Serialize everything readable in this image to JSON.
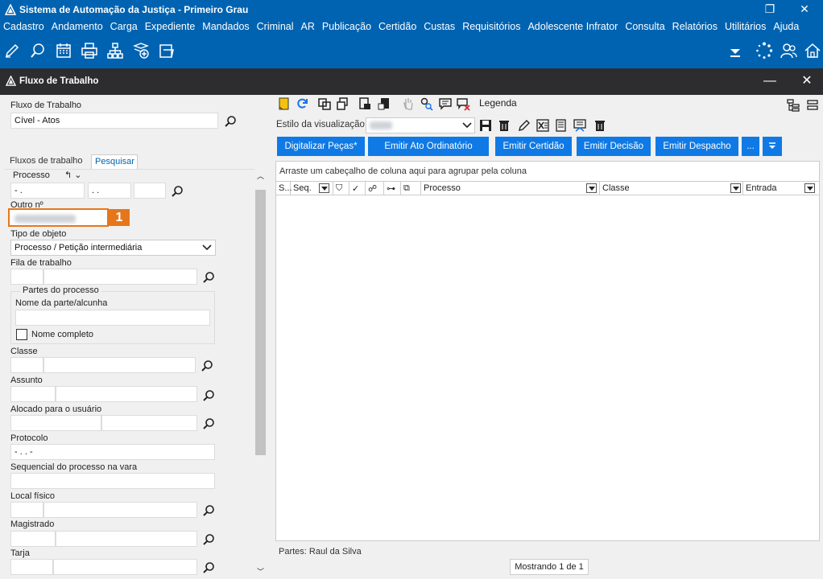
{
  "titlebar": {
    "title": "Sistema de Automação da Justiça - Primeiro Grau"
  },
  "menu": {
    "items": [
      "Cadastro",
      "Andamento",
      "Carga",
      "Expediente",
      "Mandados",
      "Criminal",
      "AR",
      "Publicação",
      "Certidão",
      "Custas",
      "Requisitórios",
      "Adolescente Infrator",
      "Consulta",
      "Relatórios",
      "Utilitários",
      "Ajuda"
    ]
  },
  "window": {
    "title": "Fluxo de Trabalho"
  },
  "left": {
    "flow_label": "Fluxo de Trabalho",
    "flow_value": "Cível - Atos",
    "tabs": [
      "Fluxos de trabalho",
      "Pesquisar"
    ],
    "processo_label": "Processo",
    "processo_seg1": "- .",
    "processo_seg2": ". .",
    "outro_label": "Outro nº",
    "marker": "1",
    "tipo_label": "Tipo de objeto",
    "tipo_value": "Processo / Petição intermediária",
    "fila_label": "Fila de trabalho",
    "partes_group": "Partes do processo",
    "nome_parte_label": "Nome da parte/alcunha",
    "nome_completo_label": "Nome completo",
    "classe_label": "Classe",
    "assunto_label": "Assunto",
    "alocado_label": "Alocado para o usuário",
    "protocolo_label": "Protocolo",
    "protocolo_value": "- . . -",
    "sequencial_label": "Sequencial do processo na vara",
    "local_label": "Local físico",
    "magistrado_label": "Magistrado",
    "tarja_label": "Tarja"
  },
  "right": {
    "legenda_label": "Legenda",
    "estilo_label": "Estilo da visualização",
    "buttons": [
      "Digitalizar Peças*",
      "Emitir Ato Ordinatório",
      "Emitir Certidão",
      "Emitir Decisão",
      "Emitir Despacho",
      "..."
    ],
    "group_hint": "Arraste um cabeçalho de coluna aqui para agrupar pela coluna",
    "columns": [
      "S...",
      "Seq.",
      "Processo",
      "Classe",
      "Entrada"
    ],
    "partes_footer": "Partes: Raul da Silva",
    "mostrando": "Mostrando 1 de 1"
  },
  "colors": {
    "accent": "#0063b1",
    "button": "#0f7ae5",
    "marker": "#e6761b",
    "subbar": "#2d2d30"
  }
}
